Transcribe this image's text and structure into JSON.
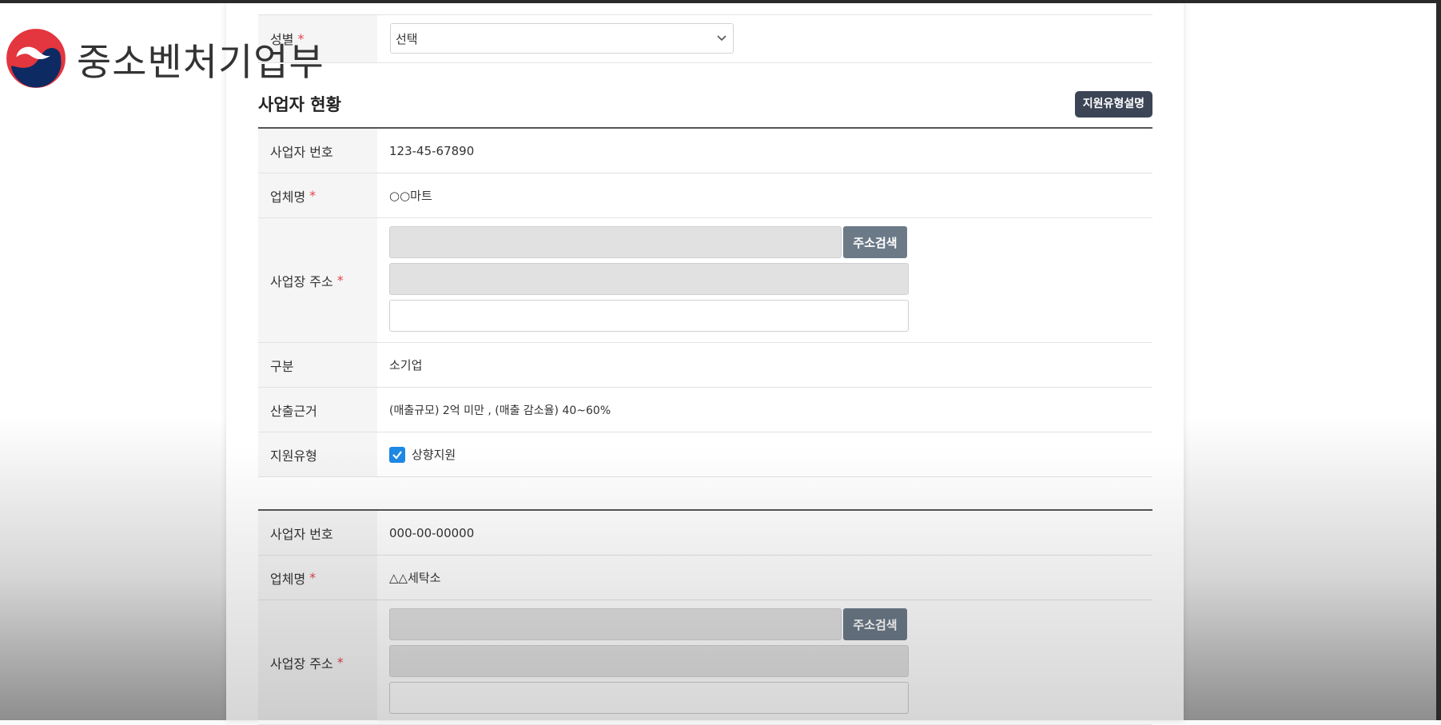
{
  "brand": {
    "name": "중소벤처기업부"
  },
  "top_section": {
    "gender_label": "성별",
    "required_mark": "*",
    "gender_value": "선택"
  },
  "business": {
    "section_title": "사업자 현황",
    "support_type_button": "지원유형설명",
    "entries": [
      {
        "biz_no_label": "사업자 번호",
        "biz_no": "123-45-67890",
        "company_label": "업체명",
        "company": "○○마트",
        "address_label": "사업장 주소",
        "address_search_button": "주소검색",
        "category_label": "구분",
        "category": "소기업",
        "basis_label": "산출근거",
        "basis": "(매출규모) 2억 미만 , (매출 감소율) 40~60%",
        "support_label": "지원유형",
        "support_option": "상향지원",
        "support_checked": true
      },
      {
        "biz_no_label": "사업자 번호",
        "biz_no": "000-00-00000",
        "company_label": "업체명",
        "company": "△△세탁소",
        "address_label": "사업장 주소",
        "address_search_button": "주소검색"
      }
    ]
  },
  "icons": {
    "chevron": "chevron-down-icon",
    "check": "check-icon"
  },
  "colors": {
    "required": "#e0454e",
    "dark_button": "#3b4555",
    "search_button": "#6c7a88",
    "checkbox": "#1e88e5"
  }
}
